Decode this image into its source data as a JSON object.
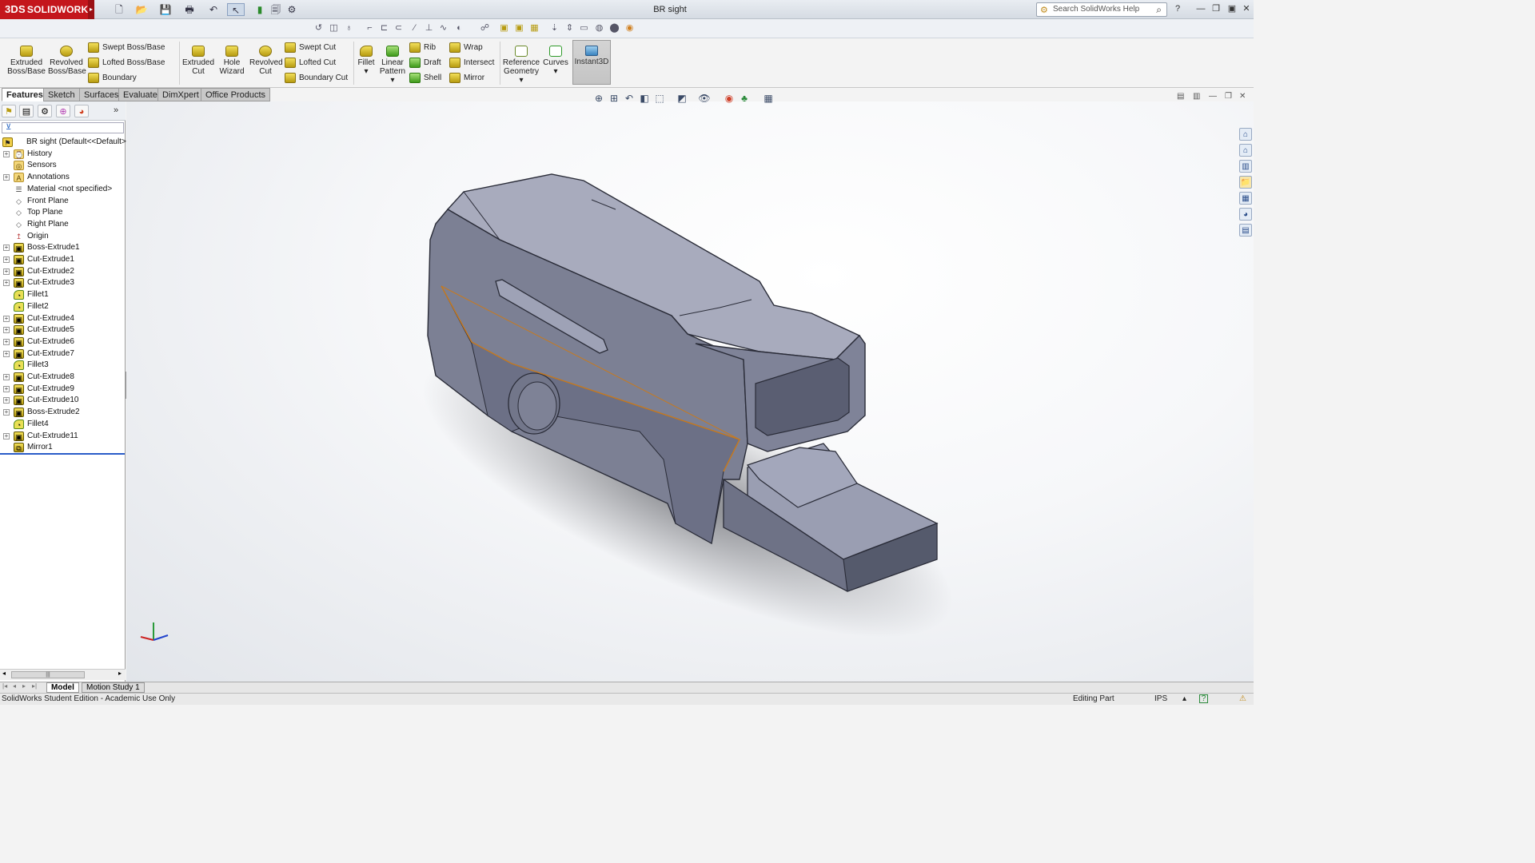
{
  "app": {
    "logo_text": "SOLIDWORKS",
    "logo_mark": "3DS",
    "document_title": "BR sight",
    "help_search_placeholder": "Search SolidWorks Help"
  },
  "ribbon": {
    "extruded_boss": "Extruded Boss/Base",
    "revolved_boss": "Revolved Boss/Base",
    "swept_boss": "Swept Boss/Base",
    "lofted_boss": "Lofted Boss/Base",
    "boundary_boss": "Boundary Boss/Base",
    "extruded_cut": "Extruded Cut",
    "hole_wizard": "Hole Wizard",
    "revolved_cut": "Revolved Cut",
    "swept_cut": "Swept Cut",
    "lofted_cut": "Lofted Cut",
    "boundary_cut": "Boundary Cut",
    "fillet": "Fillet",
    "linear_pattern": "Linear Pattern",
    "rib": "Rib",
    "draft": "Draft",
    "shell": "Shell",
    "wrap": "Wrap",
    "intersect": "Intersect",
    "mirror": "Mirror",
    "reference_geometry": "Reference Geometry",
    "curves": "Curves",
    "instant3d": "Instant3D"
  },
  "command_tabs": [
    "Features",
    "Sketch",
    "Surfaces",
    "Evaluate",
    "DimXpert",
    "Office Products"
  ],
  "feature_tree": {
    "root": "BR sight  (Default<<Default>",
    "items": [
      {
        "label": "History",
        "icon": "history-icon",
        "expandable": true
      },
      {
        "label": "Sensors",
        "icon": "sensors-icon",
        "expandable": false
      },
      {
        "label": "Annotations",
        "icon": "annotations-icon",
        "expandable": true
      },
      {
        "label": "Material <not specified>",
        "icon": "material-icon",
        "expandable": false
      },
      {
        "label": "Front Plane",
        "icon": "plane-icon",
        "expandable": false
      },
      {
        "label": "Top Plane",
        "icon": "plane-icon",
        "expandable": false
      },
      {
        "label": "Right Plane",
        "icon": "plane-icon",
        "expandable": false
      },
      {
        "label": "Origin",
        "icon": "origin-icon",
        "expandable": false
      },
      {
        "label": "Boss-Extrude1",
        "icon": "extrude-icon",
        "expandable": true
      },
      {
        "label": "Cut-Extrude1",
        "icon": "extrude-icon",
        "expandable": true
      },
      {
        "label": "Cut-Extrude2",
        "icon": "extrude-icon",
        "expandable": true
      },
      {
        "label": "Cut-Extrude3",
        "icon": "extrude-icon",
        "expandable": true
      },
      {
        "label": "Fillet1",
        "icon": "fillet-icon",
        "expandable": false
      },
      {
        "label": "Fillet2",
        "icon": "fillet-icon",
        "expandable": false
      },
      {
        "label": "Cut-Extrude4",
        "icon": "extrude-icon",
        "expandable": true
      },
      {
        "label": "Cut-Extrude5",
        "icon": "extrude-icon",
        "expandable": true
      },
      {
        "label": "Cut-Extrude6",
        "icon": "extrude-icon",
        "expandable": true
      },
      {
        "label": "Cut-Extrude7",
        "icon": "extrude-icon",
        "expandable": true
      },
      {
        "label": "Fillet3",
        "icon": "fillet-icon",
        "expandable": false
      },
      {
        "label": "Cut-Extrude8",
        "icon": "extrude-icon",
        "expandable": true
      },
      {
        "label": "Cut-Extrude9",
        "icon": "extrude-icon",
        "expandable": true
      },
      {
        "label": "Cut-Extrude10",
        "icon": "extrude-icon",
        "expandable": true
      },
      {
        "label": "Boss-Extrude2",
        "icon": "extrude-icon",
        "expandable": true
      },
      {
        "label": "Fillet4",
        "icon": "fillet-icon",
        "expandable": false
      },
      {
        "label": "Cut-Extrude11",
        "icon": "extrude-icon",
        "expandable": true
      },
      {
        "label": "Mirror1",
        "icon": "mirror-icon",
        "expandable": false
      }
    ]
  },
  "bottom_tabs": [
    "Model",
    "Motion Study 1"
  ],
  "status": {
    "left": "SolidWorks Student Edition - Academic Use Only",
    "mode": "Editing Part",
    "units": "IPS"
  },
  "colors": {
    "brand": "#c4161c",
    "model_face": "#8e92a6",
    "edge_highlight": "#c87a1e"
  }
}
